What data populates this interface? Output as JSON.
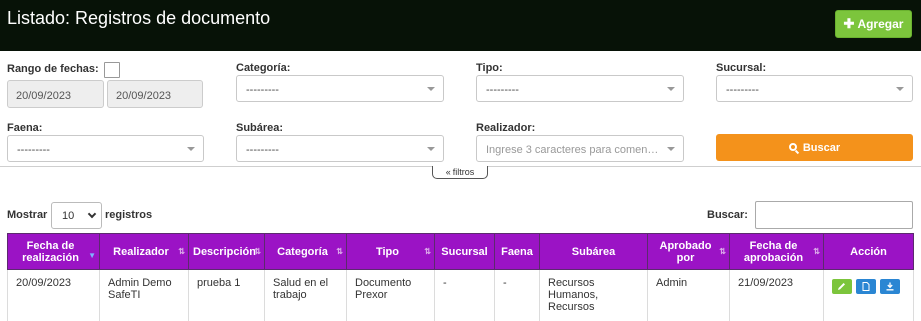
{
  "header": {
    "title": "Listado: Registros de documento",
    "add_label": "Agregar",
    "add_icon": "plus-icon"
  },
  "filters": {
    "date_range_label": "Rango de fechas:",
    "date_from": "20/09/2023",
    "date_to": "20/09/2023",
    "categoria_label": "Categoría:",
    "categoria_value": "---------",
    "tipo_label": "Tipo:",
    "tipo_value": "---------",
    "sucursal_label": "Sucursal:",
    "sucursal_value": "---------",
    "faena_label": "Faena:",
    "faena_value": "---------",
    "subarea_label": "Subárea:",
    "subarea_value": "---------",
    "realizador_label": "Realizador:",
    "realizador_placeholder": "Ingrese 3 caracteres para comen…",
    "search_button": "Buscar",
    "toggle_label": "filtros"
  },
  "table_controls": {
    "show_label": "Mostrar",
    "page_length": "10",
    "records_label": "registros",
    "search_label": "Buscar:"
  },
  "table": {
    "columns": [
      {
        "label": "Fecha de realización"
      },
      {
        "label": "Realizador"
      },
      {
        "label": "Descripción"
      },
      {
        "label": "Categoría"
      },
      {
        "label": "Tipo"
      },
      {
        "label": "Sucursal"
      },
      {
        "label": "Faena"
      },
      {
        "label": "Subárea"
      },
      {
        "label": "Aprobado por"
      },
      {
        "label": "Fecha de aprobación"
      },
      {
        "label": "Acción"
      }
    ],
    "rows": [
      {
        "fecha": "20/09/2023",
        "realizador": "Admin Demo SafeTI",
        "descripcion": "prueba 1",
        "categoria": "Salud en el trabajo",
        "tipo": "Documento Prexor",
        "sucursal": "-",
        "faena": "-",
        "subarea": "Recursos Humanos, Recursos",
        "aprobado": "Admin",
        "fecha_aprobacion": "21/09/2023"
      }
    ]
  },
  "colors": {
    "topbar": "#071207",
    "add_button": "#7cc53c",
    "search_button": "#f4921b",
    "table_header": "#9b13c5",
    "action_green": "#7cc53c",
    "action_blue": "#2a86d3"
  }
}
